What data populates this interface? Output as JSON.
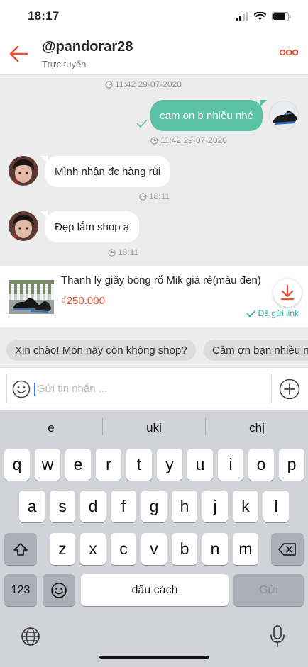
{
  "status_bar": {
    "time": "18:17"
  },
  "header": {
    "username": "@pandorar28",
    "status": "Trực tuyến"
  },
  "messages": {
    "top_timestamp": "11:42 29-07-2020",
    "outgoing_text": "cam on b nhiều nhé",
    "outgoing_timestamp": "11:42 29-07-2020",
    "incoming_1_text": "Mình nhận đc hàng rùi",
    "incoming_1_time": "18:11",
    "incoming_2_text": "Đẹp lắm shop ạ",
    "incoming_2_time": "18:11"
  },
  "product": {
    "name": "Thanh lý giầy bóng rổ Mik giá rẻ(màu đen)",
    "price": "₫250.000",
    "sent_label": "Đã gửi link"
  },
  "quick_replies": [
    "Xin chào! Món này còn không shop?",
    "Cảm ơn bạn nhiều nhé"
  ],
  "input": {
    "placeholder": "Gửi tin nhắn ..."
  },
  "keyboard": {
    "suggestions": [
      "e",
      "uki",
      "chị"
    ],
    "row1": [
      "q",
      "w",
      "e",
      "r",
      "t",
      "y",
      "u",
      "i",
      "o",
      "p"
    ],
    "row2": [
      "a",
      "s",
      "d",
      "f",
      "g",
      "h",
      "j",
      "k",
      "l"
    ],
    "row3": [
      "z",
      "x",
      "c",
      "v",
      "b",
      "n",
      "m"
    ],
    "numbers_key": "123",
    "space_key": "dấu cách",
    "send_key": "Gửi"
  },
  "colors": {
    "accent": "#ee4d2d",
    "outgoing_bubble": "#5ac1a6",
    "sent_green": "#26aa99"
  }
}
